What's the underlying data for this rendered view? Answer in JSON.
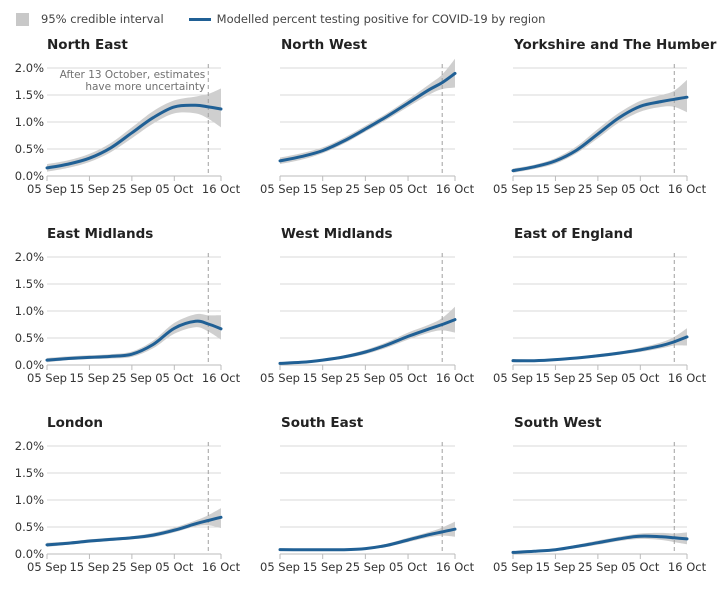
{
  "legend": {
    "interval_label": "95% credible interval",
    "line_label": "Modelled percent testing positive for COVID-19 by region"
  },
  "colors": {
    "line": "#206095",
    "band": "#cfcfcf",
    "grid": "#d9d9d9",
    "dashed": "#a0a0a0"
  },
  "chart_data": {
    "type": "line",
    "title": "Modelled percent testing positive for COVID-19 by region",
    "xlabel": "",
    "ylabel": "",
    "x_unit": "days since 05 Sep 2020",
    "xlim": [
      0,
      41
    ],
    "ylim": [
      0,
      2.0
    ],
    "yticks": [
      "0.0%",
      "0.5%",
      "1.0%",
      "1.5%",
      "2.0%"
    ],
    "ytick_values": [
      0,
      0.5,
      1.0,
      1.5,
      2.0
    ],
    "xticks": [
      "05 Sep",
      "15 Sep",
      "25 Sep",
      "05 Oct",
      "16 Oct"
    ],
    "xtick_values": [
      0,
      10,
      20,
      30,
      41
    ],
    "grid": true,
    "legend_position": "top-left",
    "uncertainty_marker": {
      "x": 38,
      "label": "13 October"
    },
    "annotation": [
      "After 13 October, estimates",
      "have more uncertainty"
    ],
    "x": [
      0,
      5,
      10,
      15,
      20,
      25,
      30,
      35,
      38,
      41
    ],
    "panels": [
      {
        "name": "North East",
        "values": [
          0.15,
          0.22,
          0.33,
          0.52,
          0.8,
          1.08,
          1.28,
          1.31,
          1.28,
          1.24
        ],
        "lower": [
          0.08,
          0.15,
          0.26,
          0.44,
          0.7,
          0.97,
          1.16,
          1.16,
          1.06,
          0.9
        ],
        "upper": [
          0.22,
          0.29,
          0.41,
          0.61,
          0.9,
          1.2,
          1.4,
          1.47,
          1.52,
          1.62
        ]
      },
      {
        "name": "North West",
        "values": [
          0.28,
          0.36,
          0.47,
          0.65,
          0.87,
          1.1,
          1.35,
          1.6,
          1.73,
          1.9
        ],
        "lower": [
          0.22,
          0.3,
          0.42,
          0.6,
          0.82,
          1.04,
          1.28,
          1.51,
          1.61,
          1.64
        ],
        "upper": [
          0.34,
          0.42,
          0.53,
          0.71,
          0.93,
          1.16,
          1.42,
          1.7,
          1.88,
          2.17
        ]
      },
      {
        "name": "Yorkshire and The Humber",
        "values": [
          0.1,
          0.17,
          0.28,
          0.48,
          0.78,
          1.08,
          1.29,
          1.38,
          1.42,
          1.46
        ],
        "lower": [
          0.06,
          0.13,
          0.23,
          0.42,
          0.7,
          0.99,
          1.19,
          1.28,
          1.28,
          1.18
        ],
        "upper": [
          0.14,
          0.21,
          0.33,
          0.55,
          0.87,
          1.17,
          1.39,
          1.5,
          1.58,
          1.78
        ]
      },
      {
        "name": "East Midlands",
        "values": [
          0.09,
          0.12,
          0.14,
          0.16,
          0.2,
          0.38,
          0.68,
          0.81,
          0.76,
          0.67
        ],
        "lower": [
          0.05,
          0.09,
          0.11,
          0.12,
          0.15,
          0.31,
          0.58,
          0.7,
          0.62,
          0.47
        ],
        "upper": [
          0.13,
          0.16,
          0.18,
          0.2,
          0.25,
          0.45,
          0.78,
          0.94,
          0.92,
          0.92
        ]
      },
      {
        "name": "West Midlands",
        "values": [
          0.03,
          0.05,
          0.09,
          0.15,
          0.24,
          0.37,
          0.53,
          0.67,
          0.75,
          0.84
        ],
        "lower": [
          0.01,
          0.03,
          0.07,
          0.12,
          0.2,
          0.32,
          0.47,
          0.6,
          0.64,
          0.6
        ],
        "upper": [
          0.05,
          0.07,
          0.11,
          0.18,
          0.28,
          0.42,
          0.6,
          0.75,
          0.87,
          1.08
        ]
      },
      {
        "name": "East of England",
        "values": [
          0.08,
          0.08,
          0.1,
          0.13,
          0.17,
          0.22,
          0.28,
          0.36,
          0.43,
          0.52
        ],
        "lower": [
          0.05,
          0.06,
          0.08,
          0.11,
          0.14,
          0.19,
          0.24,
          0.31,
          0.36,
          0.36
        ],
        "upper": [
          0.11,
          0.1,
          0.12,
          0.15,
          0.2,
          0.25,
          0.32,
          0.42,
          0.52,
          0.68
        ]
      },
      {
        "name": "London",
        "values": [
          0.17,
          0.2,
          0.24,
          0.27,
          0.3,
          0.35,
          0.44,
          0.56,
          0.62,
          0.68
        ],
        "lower": [
          0.13,
          0.17,
          0.21,
          0.24,
          0.27,
          0.31,
          0.4,
          0.51,
          0.53,
          0.48
        ],
        "upper": [
          0.21,
          0.23,
          0.27,
          0.3,
          0.33,
          0.39,
          0.49,
          0.62,
          0.72,
          0.85
        ]
      },
      {
        "name": "South East",
        "values": [
          0.08,
          0.08,
          0.08,
          0.08,
          0.1,
          0.16,
          0.26,
          0.36,
          0.41,
          0.46
        ],
        "lower": [
          0.06,
          0.06,
          0.06,
          0.06,
          0.08,
          0.13,
          0.22,
          0.31,
          0.34,
          0.32
        ],
        "upper": [
          0.1,
          0.1,
          0.1,
          0.1,
          0.12,
          0.19,
          0.3,
          0.41,
          0.49,
          0.6
        ]
      },
      {
        "name": "South West",
        "values": [
          0.03,
          0.05,
          0.08,
          0.14,
          0.21,
          0.28,
          0.33,
          0.32,
          0.3,
          0.28
        ],
        "lower": [
          0.01,
          0.03,
          0.06,
          0.11,
          0.17,
          0.24,
          0.28,
          0.26,
          0.22,
          0.18
        ],
        "upper": [
          0.05,
          0.07,
          0.1,
          0.17,
          0.25,
          0.32,
          0.38,
          0.39,
          0.38,
          0.4
        ]
      }
    ]
  }
}
